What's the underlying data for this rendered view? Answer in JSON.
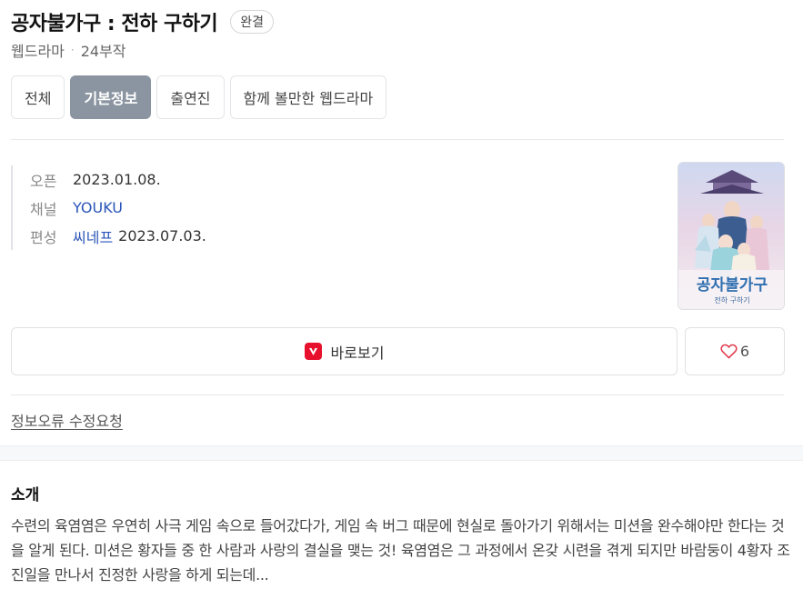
{
  "header": {
    "title": "공자불가구 : 전하 구하기",
    "status_badge": "완결",
    "genre": "웹드라마",
    "separator": "·",
    "episodes": "24부작"
  },
  "tabs": [
    {
      "label": "전체",
      "active": false
    },
    {
      "label": "기본정보",
      "active": true
    },
    {
      "label": "출연진",
      "active": false
    },
    {
      "label": "함께 볼만한 웹드라마",
      "active": false
    }
  ],
  "info": {
    "open": {
      "key": "오픈",
      "value": "2023.01.08."
    },
    "channel": {
      "key": "채널",
      "value": "YOUKU"
    },
    "programming": {
      "key": "편성",
      "link": "씨네프",
      "date": "2023.07.03."
    }
  },
  "poster": {
    "title_text": "공자불가구",
    "subtitle_text": "전하 구하기"
  },
  "actions": {
    "watch_label": "바로보기",
    "like_count": "6",
    "app_icon": "tving-app-icon",
    "like_icon": "heart-icon"
  },
  "report_link": "정보오류 수정요청",
  "intro": {
    "title": "소개",
    "text": "수련의 육염염은 우연히 사극 게임 속으로 들어갔다가, 게임 속 버그 때문에 현실로 돌아가기 위해서는 미션을 완수해야만 한다는 것을 알게 된다. 미션은 황자들 중 한 사람과 사랑의 결실을 맺는 것! 육염염은 그 과정에서 온갖 시련을 겪게 되지만 바람둥이 4황자 조진일을 만나서 진정한 사랑을 하게 되는데..."
  },
  "colors": {
    "active_tab": "#8b95a1",
    "link": "#2a55b8",
    "app_icon": "#e8112d",
    "heart": "#e2364a"
  }
}
